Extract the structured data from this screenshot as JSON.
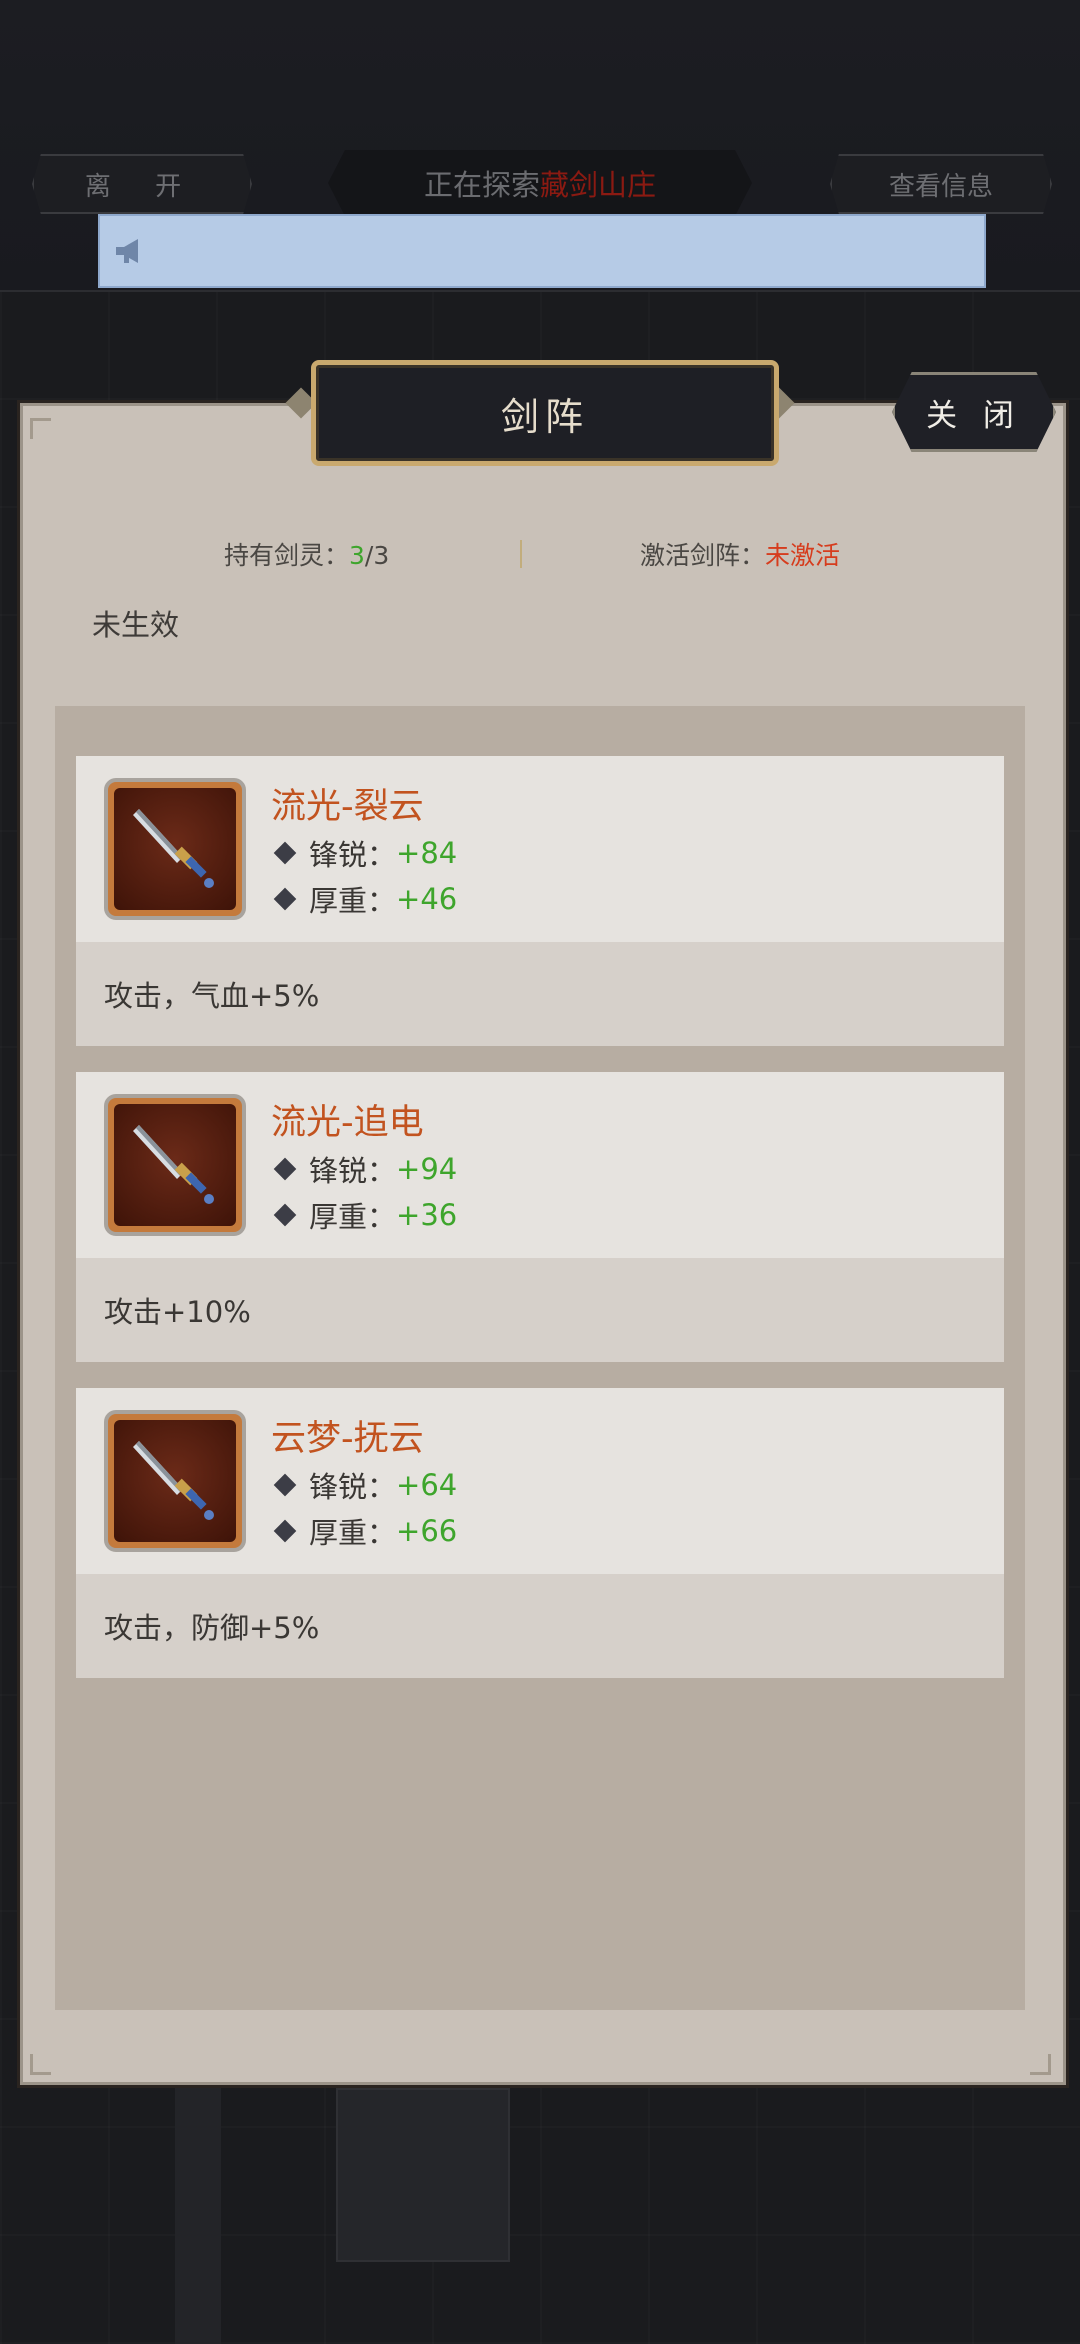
{
  "topbar": {
    "leave_label": "离 开",
    "exploring_prefix": "正在探索",
    "exploring_place": "藏剑山庄",
    "view_info_label": "查看信息"
  },
  "dialog": {
    "title": "剑阵",
    "close_label": "关 闭",
    "held_label": "持有剑灵：",
    "held_current": "3",
    "held_total": "/3",
    "array_label": "激活剑阵：",
    "array_status": "未激活",
    "effect_status": "未生效"
  },
  "swords": [
    {
      "name": "流光-裂云",
      "sharp_label": "锋锐：",
      "sharp_value": "+84",
      "heavy_label": "厚重：",
      "heavy_value": "+46",
      "effect": "攻击，气血+5%"
    },
    {
      "name": "流光-追电",
      "sharp_label": "锋锐：",
      "sharp_value": "+94",
      "heavy_label": "厚重：",
      "heavy_value": "+36",
      "effect": "攻击+10%"
    },
    {
      "name": "云梦-抚云",
      "sharp_label": "锋锐：",
      "sharp_value": "+64",
      "heavy_label": "厚重：",
      "heavy_value": "+66",
      "effect": "攻击，防御+5%"
    }
  ],
  "icons": {
    "notice": "megaphone-icon",
    "sword": "sword-icon",
    "attribute": "diamond-icon"
  },
  "colors": {
    "accent_name": "#c2531f",
    "value_green": "#3ea52c",
    "status_red": "#d63c1d",
    "notice_bg": "#b6cbe6"
  }
}
